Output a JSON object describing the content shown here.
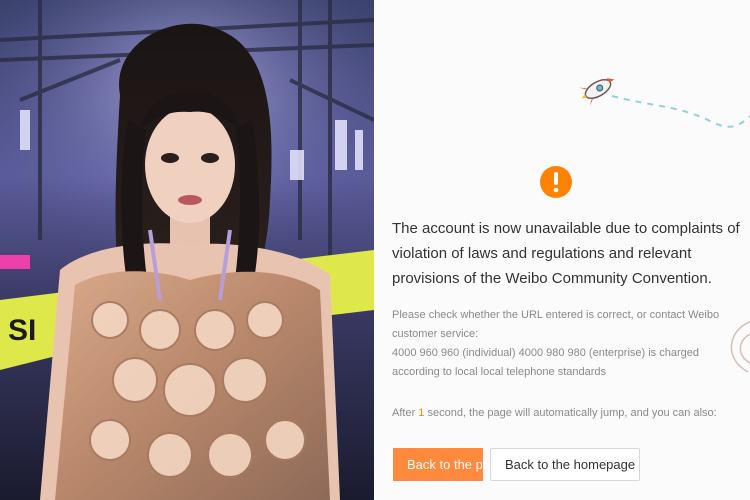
{
  "notice": {
    "headline": "The account is now unavailable due to complaints of violation of laws and regulations and relevant provisions of the Weibo Community Convention.",
    "help_line_1": "Please check whether the URL entered is correct, or contact Weibo customer service:",
    "help_line_2": "4000 960 960 (individual) 4000 980 980 (enterprise) is charged according to local local telephone standards",
    "jump_before": "After ",
    "jump_count": "1",
    "jump_after": " second, the page will automatically jump, and you can also:",
    "buttons": {
      "primary_label": "Back to the p",
      "secondary_label": "Back to the homepage"
    }
  },
  "colors": {
    "accent": "#ff8200",
    "button_primary": "#ff8a3d",
    "trail": "#8fd3d6"
  },
  "icons": {
    "alert": "exclamation-circle-icon",
    "rocket": "rocket-icon",
    "trail": "dashed-trail",
    "swirl": "swirl-decoration"
  }
}
